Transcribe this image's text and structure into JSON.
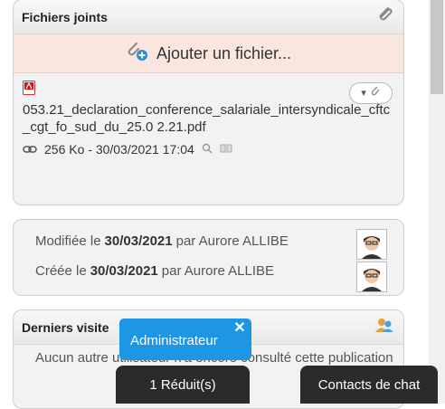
{
  "attachments": {
    "title": "Fichiers joints",
    "add_label": "Ajouter un fichier...",
    "file": {
      "name": "053.21_declaration_conference_salariale_intersyndicale_cftc_cgt_fo_sud_du_25.0 2.21.pdf",
      "size_date": "256 Ko - 30/03/2021 17:04"
    }
  },
  "history": {
    "modified": {
      "prefix": "Modifiée le",
      "date": "30/03/2021",
      "by": "par Aurore ALLIBE"
    },
    "created": {
      "prefix": "Créée le",
      "date": "30/03/2021",
      "by": "par Aurore ALLIBE"
    }
  },
  "visitors": {
    "title": "Derniers visite",
    "message": "Aucun autre utilisateur n'a encore consulté cette publication"
  },
  "tooltip": {
    "label": "Administrateur"
  },
  "chat_bar": {
    "reduced_label": "1 Réduit(s)",
    "contacts_label": "Contacts de chat"
  },
  "colors": {
    "accent": "#1e96e6",
    "add_row_bg": "#f8e6df",
    "chat_bar": "#2b2b2b"
  }
}
